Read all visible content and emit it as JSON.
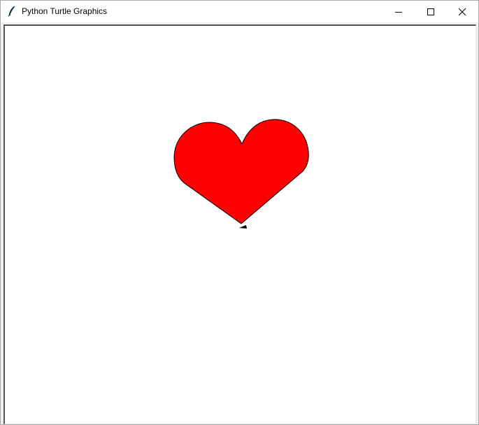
{
  "window": {
    "title": "Python Turtle Graphics",
    "app_icon": "feather-icon",
    "controls": {
      "minimize_icon": "minimize-icon",
      "maximize_icon": "maximize-icon",
      "close_icon": "close-icon"
    }
  },
  "canvas": {
    "background": "#ffffff",
    "shape": {
      "name": "heart",
      "fill": "#ff0000",
      "outline": "#000000"
    },
    "turtle_cursor": {
      "icon": "turtle-arrow-icon",
      "color": "#000000"
    }
  }
}
